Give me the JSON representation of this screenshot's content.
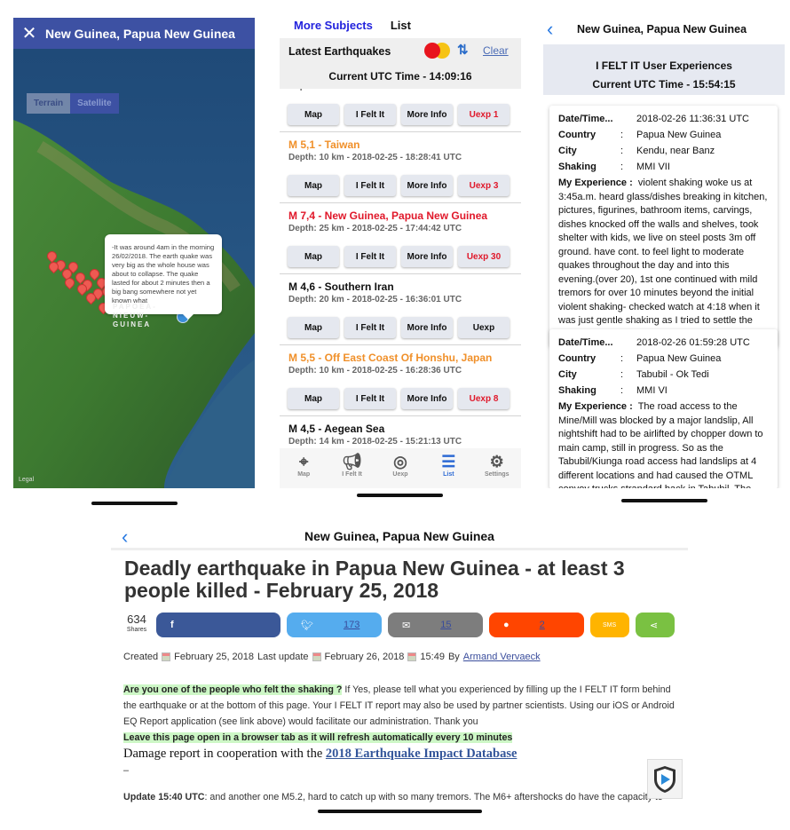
{
  "map_screen": {
    "title": "New Guinea, Papua New Guinea",
    "close_icon": "close-icon",
    "map_types": [
      "Terrain",
      "Satellite"
    ],
    "selected_map_type": "Terrain",
    "callout": "-It was around 4am in the morning 26/02/2018. The earth quake was very big as the whole house was about to collapse. The quake lasted for about 2 minutes then a big bang somewhere not yet known what",
    "map_label": [
      "PAPOEA-",
      "NIEUW-",
      "GUINEA"
    ],
    "legal": "Legal",
    "header_color": "#3d51a3"
  },
  "list_screen": {
    "nav": {
      "back_label": "More Subjects",
      "title": "List"
    },
    "header": {
      "title": "Latest Earthquakes",
      "clear": "Clear",
      "utc": "Current UTC Time - 14:09:16"
    },
    "partial_item": {
      "details": "Depth: 10 km - 2018-02-25 - 19:40:49 UTC",
      "uexp": "Uexp 1"
    },
    "buttons": {
      "map": "Map",
      "felt": "I Felt It",
      "info": "More Info"
    },
    "items": [
      {
        "title": "M 5,1 - Taiwan",
        "details": "Depth: 10 km - 2018-02-25 - 18:28:41 UTC",
        "uexp": "Uexp 3",
        "color": "#f0902a"
      },
      {
        "title": "M 7,4 - New Guinea, Papua New Guinea",
        "details": "Depth: 25 km - 2018-02-25 - 17:44:42 UTC",
        "uexp": "Uexp 30",
        "color": "#e0182a"
      },
      {
        "title": "M 4,6 - Southern Iran",
        "details": "Depth: 20 km - 2018-02-25 - 16:36:01 UTC",
        "uexp": "Uexp",
        "color": "#111111"
      },
      {
        "title": "M 5,5 - Off East Coast Of Honshu, Japan",
        "details": "Depth: 10 km - 2018-02-25 - 16:28:36 UTC",
        "uexp": "Uexp 8",
        "color": "#f0902a"
      },
      {
        "title": "M 4,5 - Aegean Sea",
        "details": "Depth: 14 km - 2018-02-25 - 15:21:13 UTC",
        "color": "#111111"
      }
    ],
    "tabbar": [
      {
        "label": "Map",
        "icon": "map-pin-icon"
      },
      {
        "label": "I Felt It",
        "icon": "megaphone-icon"
      },
      {
        "label": "Uexp",
        "icon": "compass-icon"
      },
      {
        "label": "List",
        "icon": "list-icon",
        "selected": true
      },
      {
        "label": "Settings",
        "icon": "gear-icon"
      }
    ]
  },
  "felt_screen": {
    "title": "New Guinea, Papua New Guinea",
    "band_title": "I FELT IT User Experiences",
    "utc": "Current UTC Time - 15:54:15",
    "labels": {
      "date": "Date/Time...",
      "country": "Country",
      "city": "City",
      "shaking": "Shaking",
      "experience": "My Experience :"
    },
    "reports": [
      {
        "date": "2018-02-26 11:36:31 UTC",
        "country": "Papua New Guinea",
        "city": "Kendu, near Banz",
        "shaking": "MMI VII",
        "experience": "violent shaking woke us at 3:45a.m. heard glass/dishes breaking in kitchen, pictures, figurines, bathroom items, carvings, dishes knocked off the walls and shelves, took shelter with kids, we live on steel posts 3m off ground. have cont. to feel light to moderate quakes throughout the day and into this evening.(over 20), 1st one continued with mild tremors for over 10 minutes beyond the initial violent shaking- checked watch at 4:18 when it was just gentle shaking as I tried to settle the kids."
      },
      {
        "date": "2018-02-26 01:59:28 UTC",
        "country": "Papua New Guinea",
        "city": "Tabubil - Ok Tedi",
        "shaking": "MMI VI",
        "experience": "The road access to the Mine/Mill was blocked by a major landslip, All nightshift had to be airlifted by chopper down to main camp, still in progress. So as the Tabubil/Kiunga road access had landslips at 4 different locations and had caused the OTML convoy trucks strandard back in Tabubil. The main camp residence (rooms &"
      }
    ]
  },
  "article_screen": {
    "title": "New Guinea, Papua New Guinea",
    "headline": "Deadly earthquake in Papua New Guinea - at least 3 people killed - February 25, 2018",
    "shares": {
      "count": "634",
      "label": "Shares",
      "twitter": "173",
      "email": "15",
      "reddit": "2",
      "sms": "SMS"
    },
    "meta": {
      "created": "Created",
      "created_date": "February 25, 2018",
      "update_label": "Last update",
      "update_date": "February 26, 2018",
      "time": "15:49",
      "by": "By",
      "author": "Armand Vervaeck"
    },
    "question": "Are you one of the people who felt the shaking ?",
    "question_body": " If Yes, please tell what you experienced by filling up the I FELT IT form behind the earthquake or at the bottom of this page. Your I FELT IT report may also be used by partner scientists. Using our iOS or Android EQ Report application (see link above) would facilitate our administration. Thank you",
    "refresh_note": "Leave this page open  in a browser tab as it will refresh automatically every 10 minutes",
    "damage_prefix": "Damage report in cooperation with the ",
    "damage_link": "2018 Earthquake Impact Database",
    "dash": "–",
    "update_label": "Update 15:40 UTC",
    "update_text": ": and another one M5.2, hard to catch up with so many tremors. The M6+ aftershocks do have the capacity to",
    "colors": {
      "facebook": "#3b5898",
      "twitter": "#55acee",
      "email": "#7d7d7d",
      "reddit": "#ff4500",
      "sms": "#ffb400",
      "share": "#7ac142"
    }
  }
}
